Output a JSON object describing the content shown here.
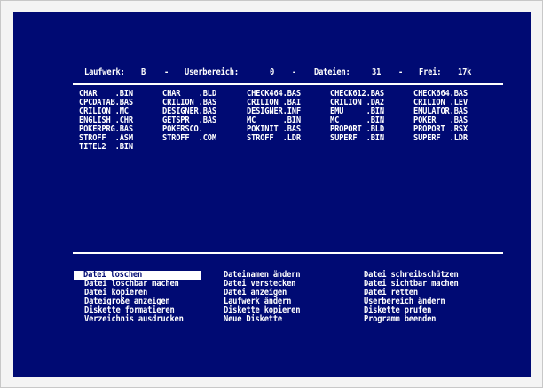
{
  "header": {
    "drive_label": "Laufwerk:",
    "drive_value": "B",
    "sep1": "-",
    "user_label": "Userbereich:",
    "user_value": "0",
    "sep2": "-",
    "files_label": "Dateien:",
    "files_value": "31",
    "sep3": "-",
    "free_label": "Frei:",
    "free_value": "17k"
  },
  "files": {
    "col1": [
      "CHAR    .BIN",
      "CPCDATAB.BAS",
      "CRILION .MC",
      "ENGLISH .CHR",
      "POKERPRG.BAS",
      "STROFF  .ASM",
      "TITEL2  .BIN"
    ],
    "col2": [
      "CHAR    .BLD",
      "CRILION .BAS",
      "DESIGNER.BAS",
      "GETSPR  .BAS",
      "POKERSCO.",
      "STROFF  .COM"
    ],
    "col3": [
      "CHECK464.BAS",
      "CRILION .BAI",
      "DESIGNER.INF",
      "MC      .BIN",
      "POKINIT .BAS",
      "STROFF  .LDR"
    ],
    "col4": [
      "CHECK612.BAS",
      "CRILION .DA2",
      "EMU     .BIN",
      "MC      .BIN",
      "PROPORT .BLD",
      "SUPERF  .BIN"
    ],
    "col5": [
      "CHECK664.BAS",
      "CRILION .LEV",
      "EMULATOR.BAS",
      "POKER   .BAS",
      "PROPORT .RSX",
      "SUPERF  .LDR"
    ]
  },
  "menu": {
    "col1": [
      "Datei loschen",
      "Datei loschbar machen",
      "Datei kopieren",
      "Dateigroße anzeigen",
      "Diskette formatieren",
      "Verzeichnis ausdrucken"
    ],
    "col2": [
      "Dateinamen ändern",
      "Datei verstecken",
      "Datei anzeigen",
      "Laufwerk ändern",
      "Diskette kopieren",
      "Neue Diskette"
    ],
    "col3": [
      "Datei schreibschützen",
      "Datei sichtbar machen",
      "Datei retten",
      "Userbereich ändern",
      "Diskette prufen",
      "Programm beenden"
    ],
    "selected": "Datei loschen"
  },
  "colors": {
    "screen_background": "#000a73",
    "text": "#ffffff",
    "frame": "#f4f4f4"
  }
}
